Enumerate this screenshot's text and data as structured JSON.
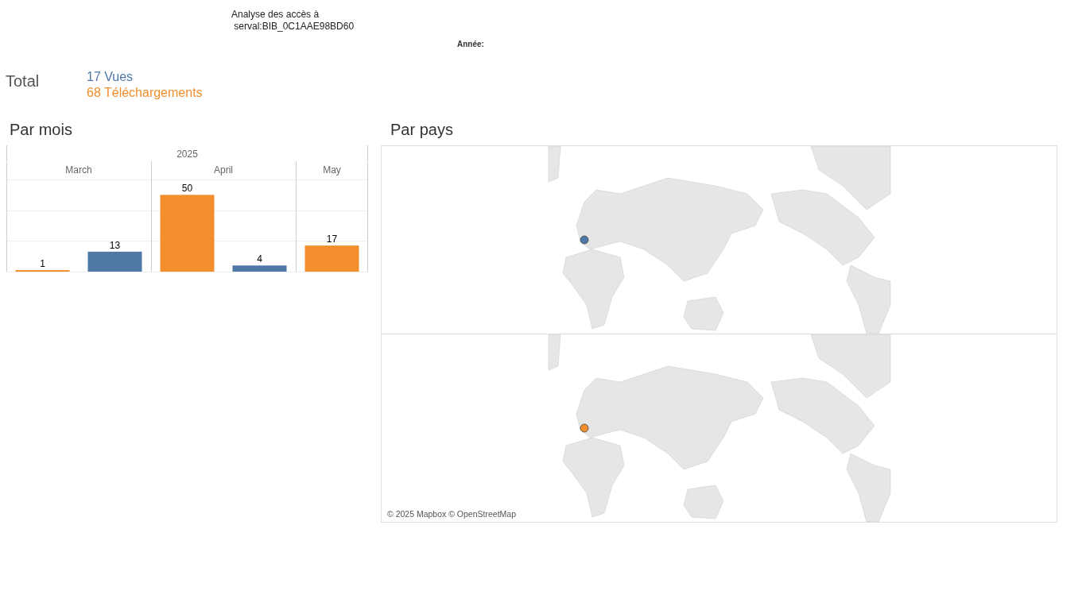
{
  "title": [
    "Analyse des accès à",
    " serval:BIB_0C1AAE98BD60"
  ],
  "filter": {
    "label": "Année:"
  },
  "total": {
    "label": "Total",
    "items": [
      {
        "text": "17 Vues",
        "color": "#4e79a7"
      },
      {
        "text": "68 Téléchargements",
        "color": "#f28e2b"
      }
    ]
  },
  "by_month": {
    "title": "Par mois",
    "year": "2025",
    "chart_data": {
      "type": "bar",
      "categories": [
        "March",
        "April",
        "May"
      ],
      "series": [
        {
          "color": "#f28e2b",
          "values": [
            1,
            50,
            17
          ]
        },
        {
          "color": "#4e79a7",
          "values": [
            13,
            4,
            null
          ]
        }
      ],
      "data_labels": true
    }
  },
  "by_country": {
    "title": "Par pays",
    "maps": [
      {
        "color": "#4e79a7"
      },
      {
        "color": "#f28e2b"
      }
    ],
    "attribution": "© 2025 Mapbox © OpenStreetMap"
  }
}
